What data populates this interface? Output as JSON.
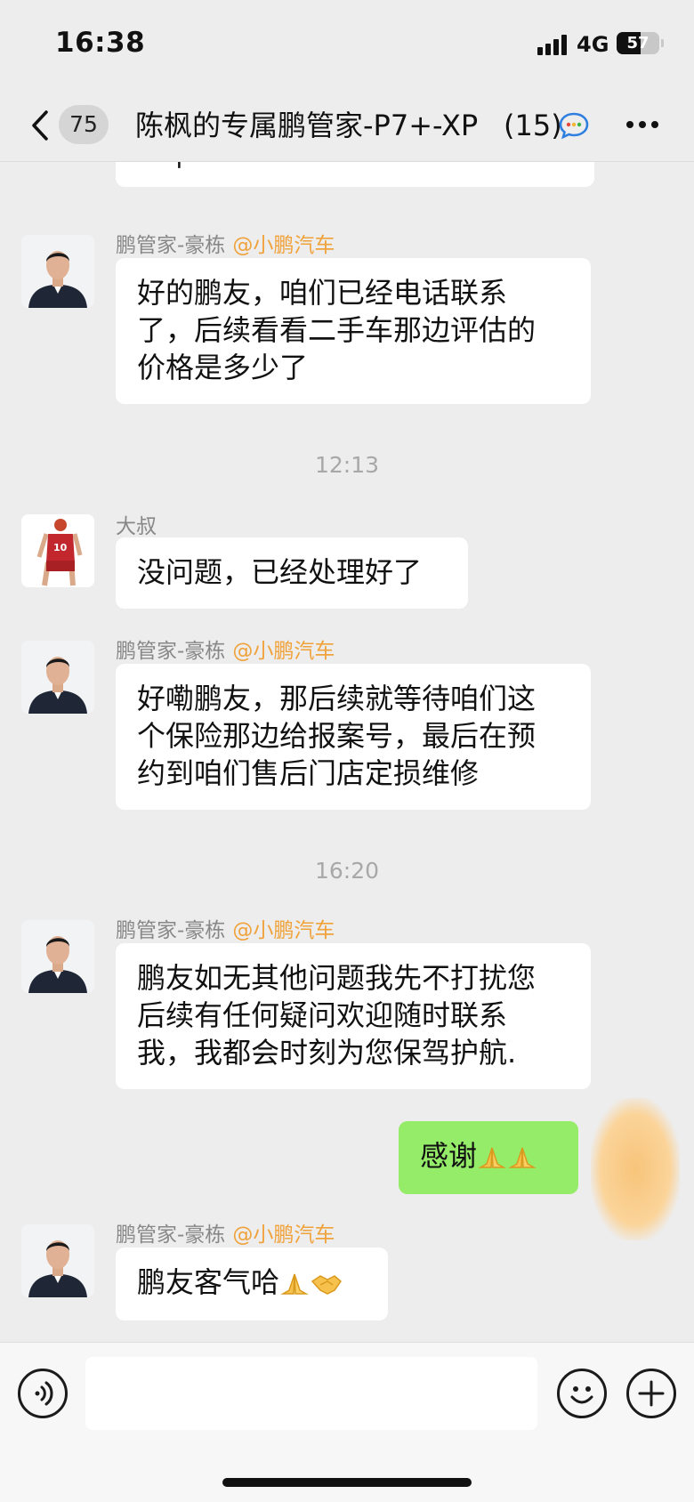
{
  "status_bar": {
    "time": "16:38",
    "network": "4G",
    "battery": "57",
    "battery_level_percent": 57
  },
  "nav": {
    "unread_count": "75",
    "title": "陈枫的专属鹏管家-P7+-XP",
    "member_count": "(15)",
    "back_icon": "chevron-left-icon",
    "channels_icon": "chat-bubble-icon",
    "more_icon": "ellipsis-icon"
  },
  "messages": {
    "partial_top": "一下",
    "m1": {
      "sender": "鹏管家-豪栋",
      "org": "@小鹏汽车",
      "line1": "好的鹏友，咱们已经电话联系",
      "line2": "了，后续看看二手车那边评估的",
      "line3": "价格是多少了"
    },
    "time1": "12:13",
    "m2": {
      "sender": "大叔",
      "text": "没问题，已经处理好了",
      "jersey_number": "10"
    },
    "m3": {
      "sender": "鹏管家-豪栋",
      "org": "@小鹏汽车",
      "line1": "好嘞鹏友，那后续就等待咱们这",
      "line2": "个保险那边给报案号，最后在预",
      "line3": "约到咱们售后门店定损维修"
    },
    "time2": "16:20",
    "m4": {
      "sender": "鹏管家-豪栋",
      "org": "@小鹏汽车",
      "line1": "鹏友如无其他问题我先不打扰您",
      "line2": "后续有任何疑问欢迎随时联系",
      "line3": "我，我都会时刻为您保驾护航."
    },
    "m5": {
      "text": "感谢",
      "emoji": "pray-hands-icon"
    },
    "m6": {
      "sender": "鹏管家-豪栋",
      "org": "@小鹏汽车",
      "text": "鹏友客气哈",
      "emoji1": "pray-hands-icon",
      "emoji2": "handshake-icon"
    }
  },
  "colors": {
    "background": "#ededed",
    "bubble_received": "#ffffff",
    "bubble_sent": "#95ec69",
    "org_tag": "#f0a23b",
    "sender_name": "#888888"
  },
  "input_bar": {
    "placeholder": "",
    "voice_icon": "voice-icon",
    "emoji_icon": "emoji-icon",
    "plus_icon": "plus-icon"
  }
}
